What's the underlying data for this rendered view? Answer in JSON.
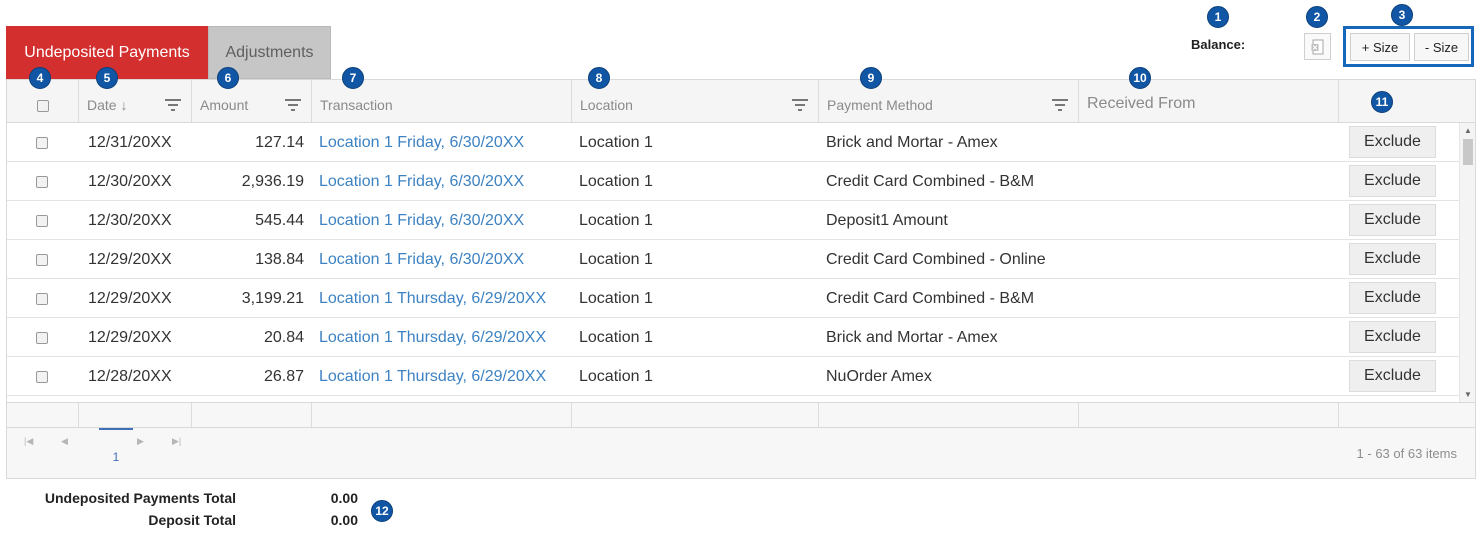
{
  "tabs": {
    "active": "Undeposited Payments",
    "inactive": "Adjustments"
  },
  "toolbar": {
    "balance_label": "Balance:",
    "size_increase": "+ Size",
    "size_decrease": "- Size"
  },
  "callouts": [
    "1",
    "2",
    "3",
    "4",
    "5",
    "6",
    "7",
    "8",
    "9",
    "10",
    "11",
    "12"
  ],
  "columns": {
    "date": "Date ↓",
    "amount": "Amount",
    "transaction": "Transaction",
    "location": "Location",
    "payment_method": "Payment Method",
    "received_from": "Received From"
  },
  "rows": [
    {
      "date": "12/31/20XX",
      "amount": "127.14",
      "transaction": "Location 1 Friday, 6/30/20XX",
      "location": "Location 1",
      "payment_method": "Brick and Mortar - Amex",
      "received_from": "",
      "action": "Exclude"
    },
    {
      "date": "12/30/20XX",
      "amount": "2,936.19",
      "transaction": "Location 1 Friday, 6/30/20XX",
      "location": "Location 1",
      "payment_method": "Credit Card Combined - B&M",
      "received_from": "",
      "action": "Exclude"
    },
    {
      "date": "12/30/20XX",
      "amount": "545.44",
      "transaction": "Location 1 Friday, 6/30/20XX",
      "location": "Location 1",
      "payment_method": "Deposit1 Amount",
      "received_from": "",
      "action": "Exclude"
    },
    {
      "date": "12/29/20XX",
      "amount": "138.84",
      "transaction": "Location 1 Friday, 6/30/20XX",
      "location": "Location 1",
      "payment_method": "Credit Card Combined - Online",
      "received_from": "",
      "action": "Exclude"
    },
    {
      "date": "12/29/20XX",
      "amount": "3,199.21",
      "transaction": "Location 1 Thursday, 6/29/20XX",
      "location": "Location 1",
      "payment_method": "Credit Card Combined - B&M",
      "received_from": "",
      "action": "Exclude"
    },
    {
      "date": "12/29/20XX",
      "amount": "20.84",
      "transaction": "Location 1 Thursday, 6/29/20XX",
      "location": "Location 1",
      "payment_method": "Brick and Mortar - Amex",
      "received_from": "",
      "action": "Exclude"
    },
    {
      "date": "12/28/20XX",
      "amount": "26.87",
      "transaction": "Location 1 Thursday, 6/29/20XX",
      "location": "Location 1",
      "payment_method": "NuOrder Amex",
      "received_from": "",
      "action": "Exclude"
    }
  ],
  "pager": {
    "current_page": "1",
    "info": "1 - 63 of 63 items"
  },
  "totals": {
    "undeposited_label": "Undeposited Payments Total",
    "undeposited_value": "0.00",
    "deposit_label": "Deposit Total",
    "deposit_value": "0.00"
  },
  "colors": {
    "active_tab": "#d32f2f",
    "inactive_tab": "#c6c6c6",
    "callout": "#1156a5",
    "highlight_border": "#1666ba",
    "link": "#3d82c2"
  }
}
